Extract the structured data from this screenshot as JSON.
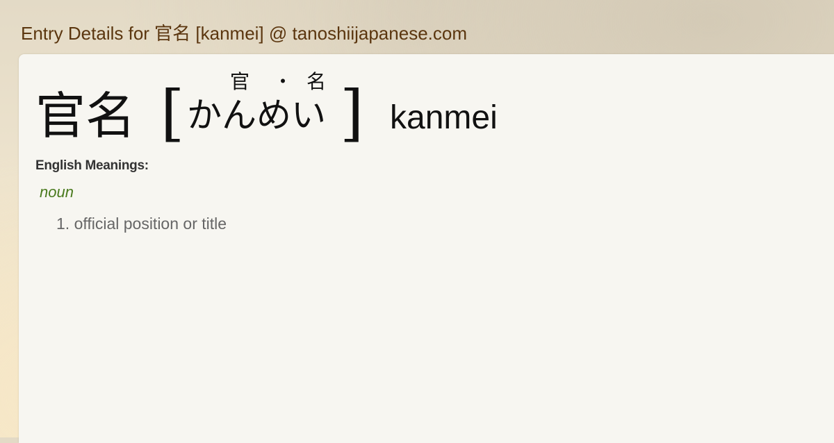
{
  "page": {
    "title": "Entry Details for 官名 [kanmei] @ tanoshiijapanese.com"
  },
  "entry": {
    "word": "官名",
    "bracket_open": "[",
    "bracket_close": "]",
    "furigana": {
      "kanji_1": "官",
      "separator": "・",
      "kanji_2": "名"
    },
    "reading": "かんめい",
    "romaji": "kanmei"
  },
  "meanings": {
    "heading": "English Meanings:",
    "part_of_speech": "noun",
    "definitions": [
      "1. official position or title"
    ]
  },
  "colors": {
    "title": "#5b360f",
    "part_of_speech": "#4a7a1e",
    "definition_text": "#666666",
    "card_background": "#f7f6f1"
  }
}
